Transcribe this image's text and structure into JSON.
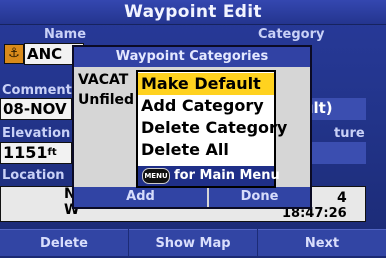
{
  "window": {
    "title": "Waypoint Edit"
  },
  "form": {
    "name_label": "Name",
    "category_label": "Category",
    "name_value": "ANC",
    "comment_label": "Comment",
    "comment_value": "08-NOV",
    "elevation_label": "Elevation",
    "elevation_value": "1151",
    "elevation_unit": "ft",
    "depth_label": "ture",
    "location_label": "Location",
    "location_ns": "N",
    "location_we": "W",
    "location_time": "18:47:26",
    "location_right_digit": "4",
    "category_value_partial": "efault)"
  },
  "categories": {
    "title": "Waypoint Categories",
    "items": [
      "VACAT",
      "Unfiled"
    ],
    "add_label": "Add",
    "done_label": "Done"
  },
  "menu": {
    "items": [
      {
        "label": "Make Default",
        "selected": true
      },
      {
        "label": "Add Category",
        "selected": false
      },
      {
        "label": "Delete Category",
        "selected": false
      },
      {
        "label": "Delete All",
        "selected": false
      }
    ],
    "footer_icon_text": "MENU",
    "footer_text": "for Main Menu"
  },
  "bottom_bar": {
    "delete_label": "Delete",
    "show_map_label": "Show Map",
    "next_label": "Next"
  },
  "colors": {
    "highlight": "#ffd21f",
    "frame": "#283a9a"
  }
}
